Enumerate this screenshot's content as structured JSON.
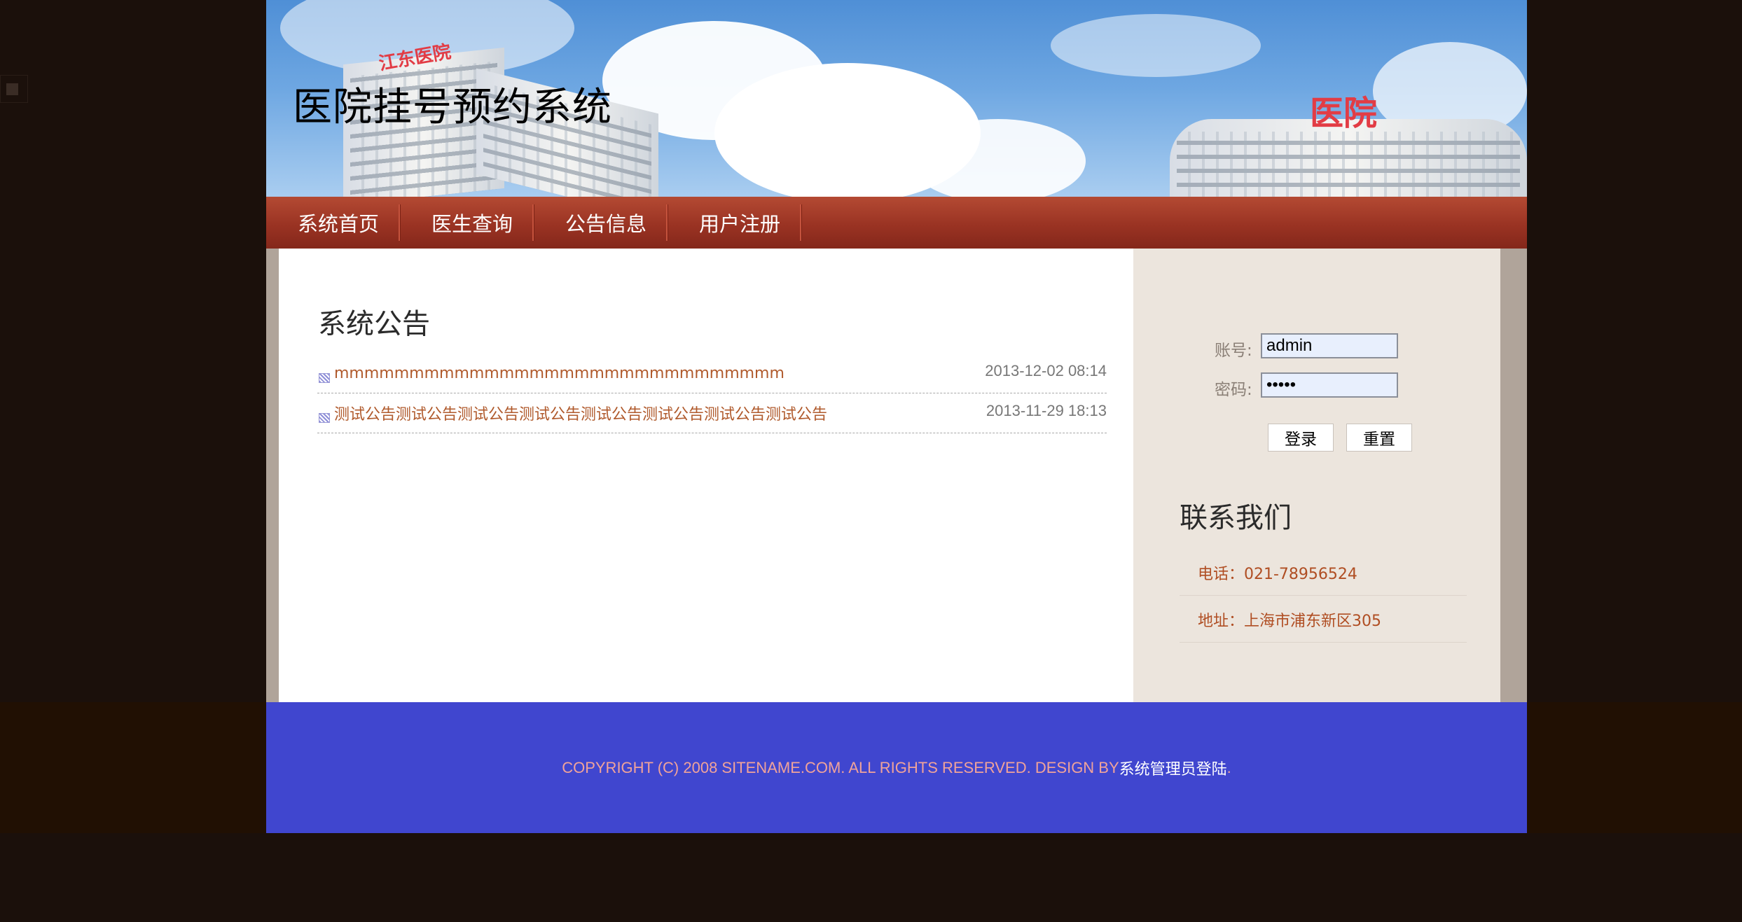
{
  "header": {
    "site_title": "医院挂号预约系统",
    "sign_left": "江东医院",
    "sign_right": "医院"
  },
  "nav": {
    "items": [
      {
        "label": "系统首页"
      },
      {
        "label": "医生查询"
      },
      {
        "label": "公告信息"
      },
      {
        "label": "用户注册"
      }
    ]
  },
  "notices": {
    "title": "系统公告",
    "items": [
      {
        "text": "mmmmmmmmmmmmmmmmmmmmmmmmmmmmmm",
        "date": "2013-12-02 08:14"
      },
      {
        "text": "测试公告测试公告测试公告测试公告测试公告测试公告测试公告测试公告",
        "date": "2013-11-29 18:13"
      }
    ]
  },
  "login": {
    "account_label": "账号:",
    "account_value": "admin",
    "password_label": "密码:",
    "password_value": "admin",
    "login_button": "登录",
    "reset_button": "重置"
  },
  "contact": {
    "title": "联系我们",
    "phone": "电话：021-78956524",
    "address": "地址：上海市浦东新区305"
  },
  "footer": {
    "copyright": "COPYRIGHT (C) 2008 SITENAME.COM. ALL RIGHTS RESERVED. DESIGN BY ",
    "admin_link": "系统管理员登陆",
    "period": "."
  },
  "colors": {
    "nav_bg": "#9a3323",
    "footer_bg": "#4046cf",
    "link": "#b05a2c",
    "sidebar_bg": "#ece5dd"
  }
}
